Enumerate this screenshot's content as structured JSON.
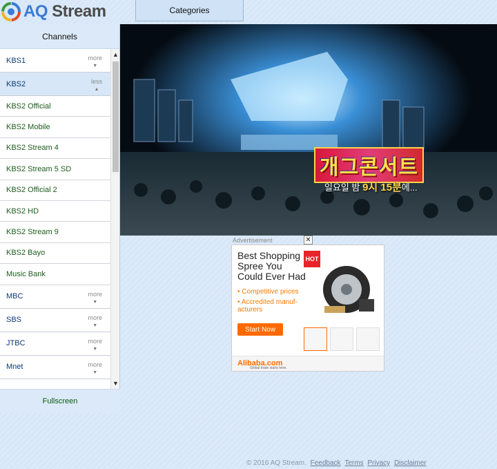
{
  "header": {
    "logo_prefix": "AQ",
    "logo_suffix": "Stream",
    "categories_label": "Categories"
  },
  "sidebar": {
    "title": "Channels",
    "channels": [
      {
        "name": "KBS1",
        "toggle": "more",
        "expanded": false
      },
      {
        "name": "KBS2",
        "toggle": "less",
        "expanded": true,
        "streams": [
          "KBS2 Official",
          "KBS2 Mobile",
          "KBS2 Stream 4",
          "KBS2 Stream 5 SD",
          "KBS2 Official 2",
          "KBS2 HD",
          "KBS2 Stream 9",
          "KBS2 Bayo",
          "Music Bank"
        ]
      },
      {
        "name": "MBC",
        "toggle": "more",
        "expanded": false
      },
      {
        "name": "SBS",
        "toggle": "more",
        "expanded": false
      },
      {
        "name": "JTBC",
        "toggle": "more",
        "expanded": false
      },
      {
        "name": "Mnet",
        "toggle": "more",
        "expanded": false
      }
    ],
    "fullscreen_label": "Fullscreen"
  },
  "video": {
    "title_overlay": "개그콘서트",
    "sub_overlay_prefix": "일요일 밤 ",
    "sub_overlay_time": "9시 15분",
    "sub_overlay_suffix": "에..."
  },
  "ad": {
    "label": "Advertisement",
    "close": "✕",
    "headline": "Best Shopping Spree You Could Ever Had",
    "bullets": [
      "• Competitive prices",
      "• Accredited manuf- acturers"
    ],
    "button": "Start Now",
    "hot_badge": "HOT",
    "brand": "Alibaba.com",
    "tagline": "Global trade starts here."
  },
  "footer": {
    "copyright": "© 2016 AQ Stream.",
    "links": [
      "Feedback",
      "Terms",
      "Privacy",
      "Disclaimer"
    ]
  },
  "colors": {
    "background": "#d7e7f8",
    "accent_orange": "#ff6a00",
    "stream_text": "#1b5c1b",
    "channel_text": "#0a3a78"
  }
}
